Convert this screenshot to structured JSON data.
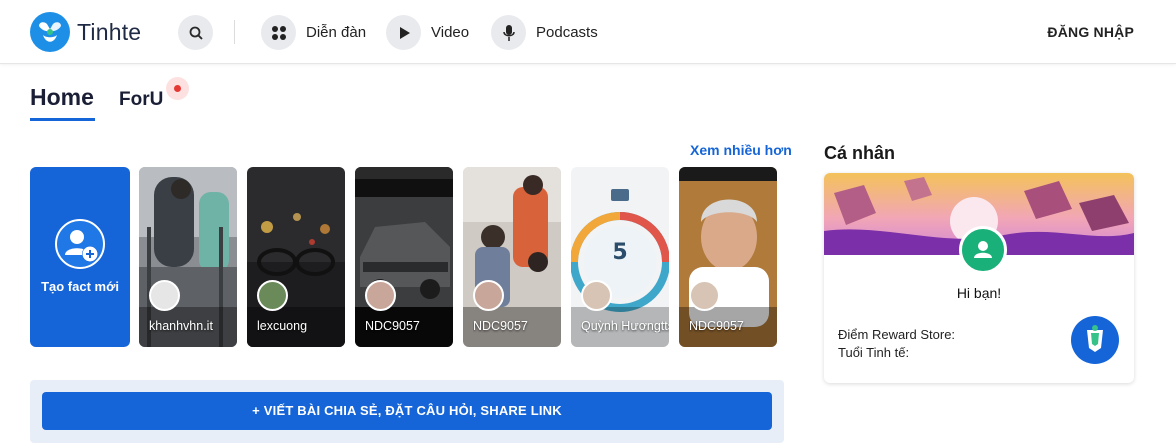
{
  "header": {
    "logo_text": "Tinhte",
    "search_icon": "search-icon",
    "nav": [
      {
        "label": "Diễn đàn",
        "icon": "grid-icon"
      },
      {
        "label": "Video",
        "icon": "play-icon"
      },
      {
        "label": "Podcasts",
        "icon": "microphone-icon"
      }
    ],
    "login_label": "ĐĂNG NHẬP"
  },
  "tabs": [
    {
      "label": "Home",
      "active": true
    },
    {
      "label": "ForU",
      "active": false
    }
  ],
  "stories": {
    "see_more": "Xem nhiều hơn",
    "create_label": "Tạo fact mới",
    "items": [
      {
        "name": "khanhvhn.it"
      },
      {
        "name": "lexcuong"
      },
      {
        "name": "NDC9057"
      },
      {
        "name": "NDC9057"
      },
      {
        "name": "Quỳnh Hươngtts"
      },
      {
        "name": "NDC9057"
      }
    ]
  },
  "compose": {
    "button_label": "+ VIẾT BÀI CHIA SẺ, ĐẶT CÂU HỎI, SHARE LINK"
  },
  "sidebar": {
    "title": "Cá nhân",
    "greeting": "Hi bạn!",
    "reward_label": "Điểm Reward Store:",
    "age_label": "Tuổi Tinh tế:"
  },
  "colors": {
    "accent": "#1565d8",
    "brand_logo": "#1e90e6",
    "notification_dot": "#e53935"
  }
}
